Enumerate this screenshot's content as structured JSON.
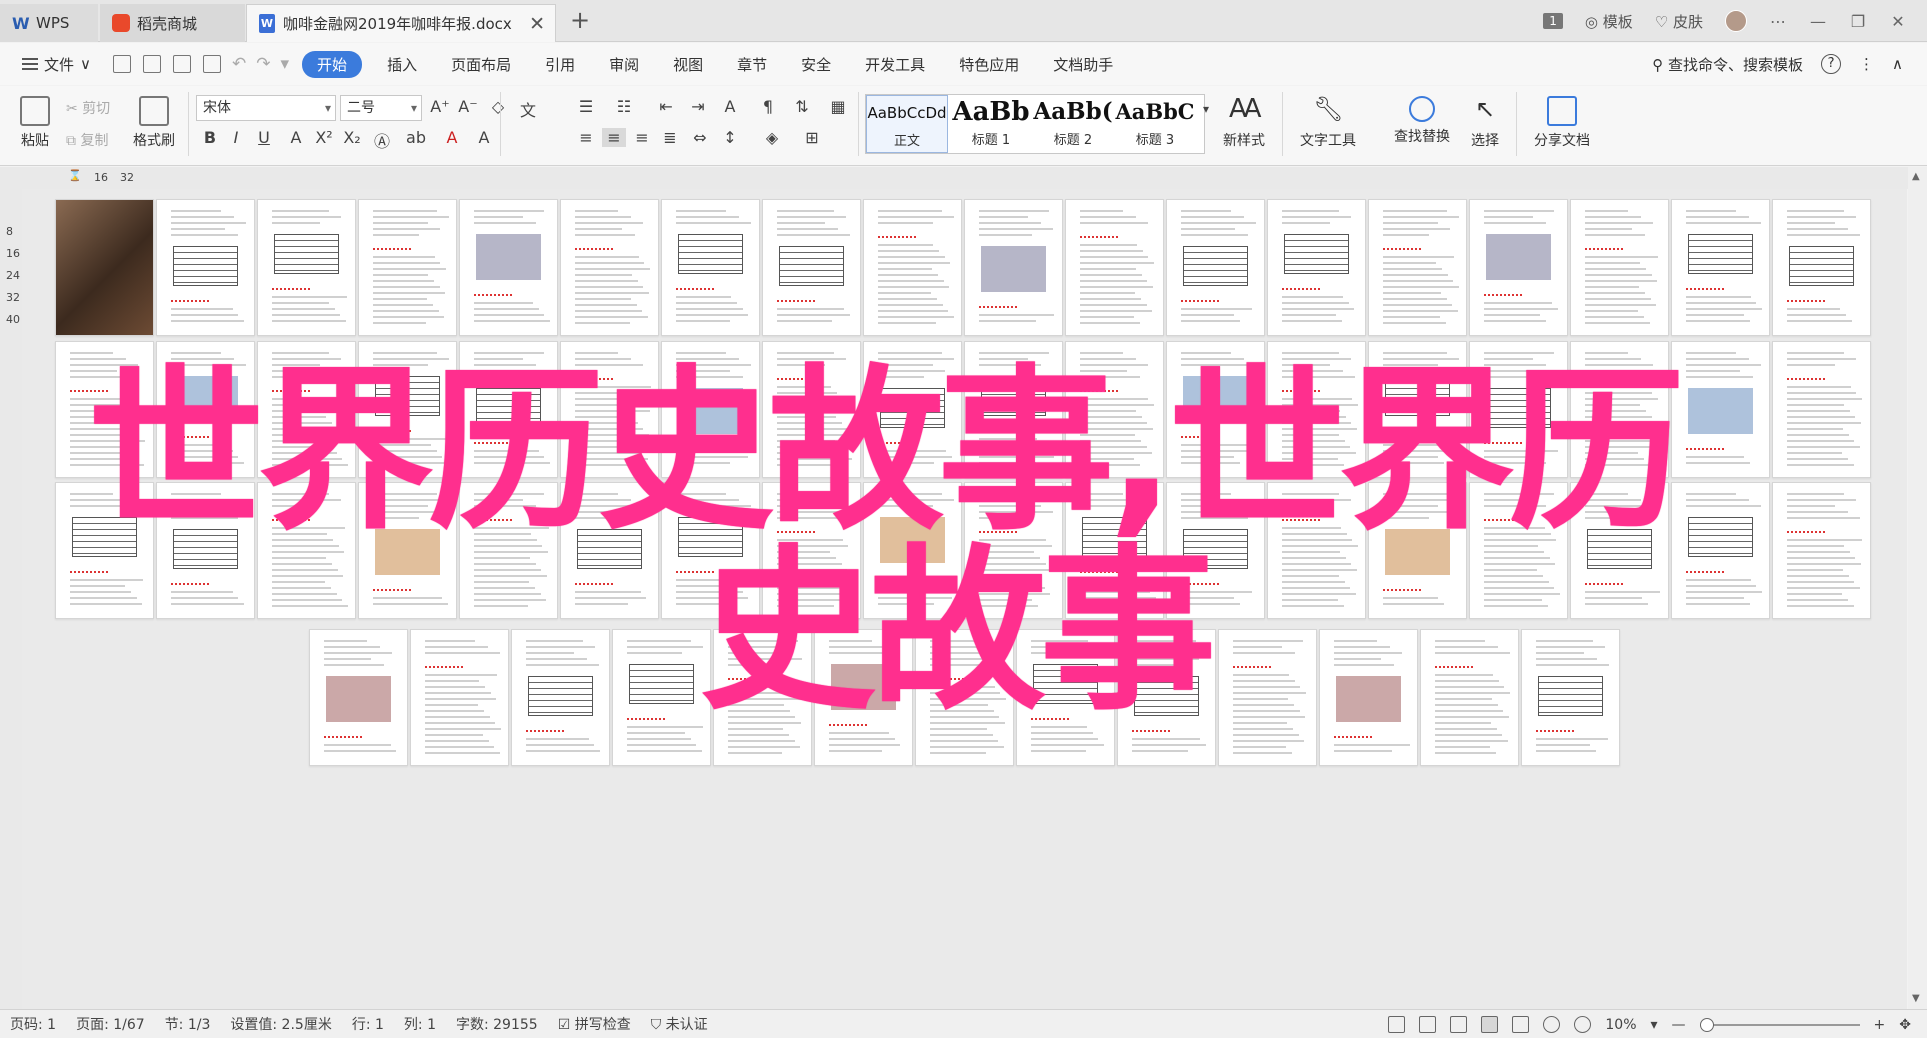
{
  "titlebar": {
    "tabs": [
      {
        "label": "WPS",
        "icon": "wps-logo-icon"
      },
      {
        "label": "稻壳商城",
        "icon": "docer-logo-icon"
      },
      {
        "label": "咖啡金融网2019年咖啡年报.docx",
        "icon": "word-doc-icon"
      }
    ],
    "badge": "1",
    "template_label": "模板",
    "skin_label": "皮肤"
  },
  "menubar": {
    "file_label": "文件",
    "items": [
      "开始",
      "插入",
      "页面布局",
      "引用",
      "审阅",
      "视图",
      "章节",
      "安全",
      "开发工具",
      "特色应用",
      "文档助手"
    ],
    "active": "开始",
    "search_label": "查找命令、搜索模板",
    "help_glyph": "?"
  },
  "ribbon": {
    "paste": "粘贴",
    "cut": "剪切",
    "copy": "复制",
    "format_painter": "格式刷",
    "font_name": "宋体",
    "font_size": "二号",
    "styles": [
      {
        "preview": "AaBbCcDd",
        "label": "正文"
      },
      {
        "preview": "AaBb",
        "label": "标题 1"
      },
      {
        "preview": "AaBb(",
        "label": "标题 2"
      },
      {
        "preview": "AaBbC",
        "label": "标题 3"
      }
    ],
    "new_style": "新样式",
    "text_tool": "文字工具",
    "find_replace": "查找替换",
    "select": "选择",
    "share": "分享文档"
  },
  "ruler": {
    "h_marks": [
      "16",
      "32"
    ],
    "v_marks": [
      "8",
      "16",
      "24",
      "32",
      "40"
    ]
  },
  "overlay": {
    "line1": "世界历史故事,世界历",
    "line2": "史故事"
  },
  "statusbar": {
    "page_num": "页码: 1",
    "page": "页面: 1/67",
    "section": "节: 1/3",
    "setting": "设置值: 2.5厘米",
    "row": "行: 1",
    "col": "列: 1",
    "words": "字数: 29155",
    "spell": "拼写检查",
    "cert": "未认证",
    "zoom": "10%"
  },
  "colors": {
    "accent": "#3b7bdc",
    "overlay": "#ff2f8e"
  }
}
